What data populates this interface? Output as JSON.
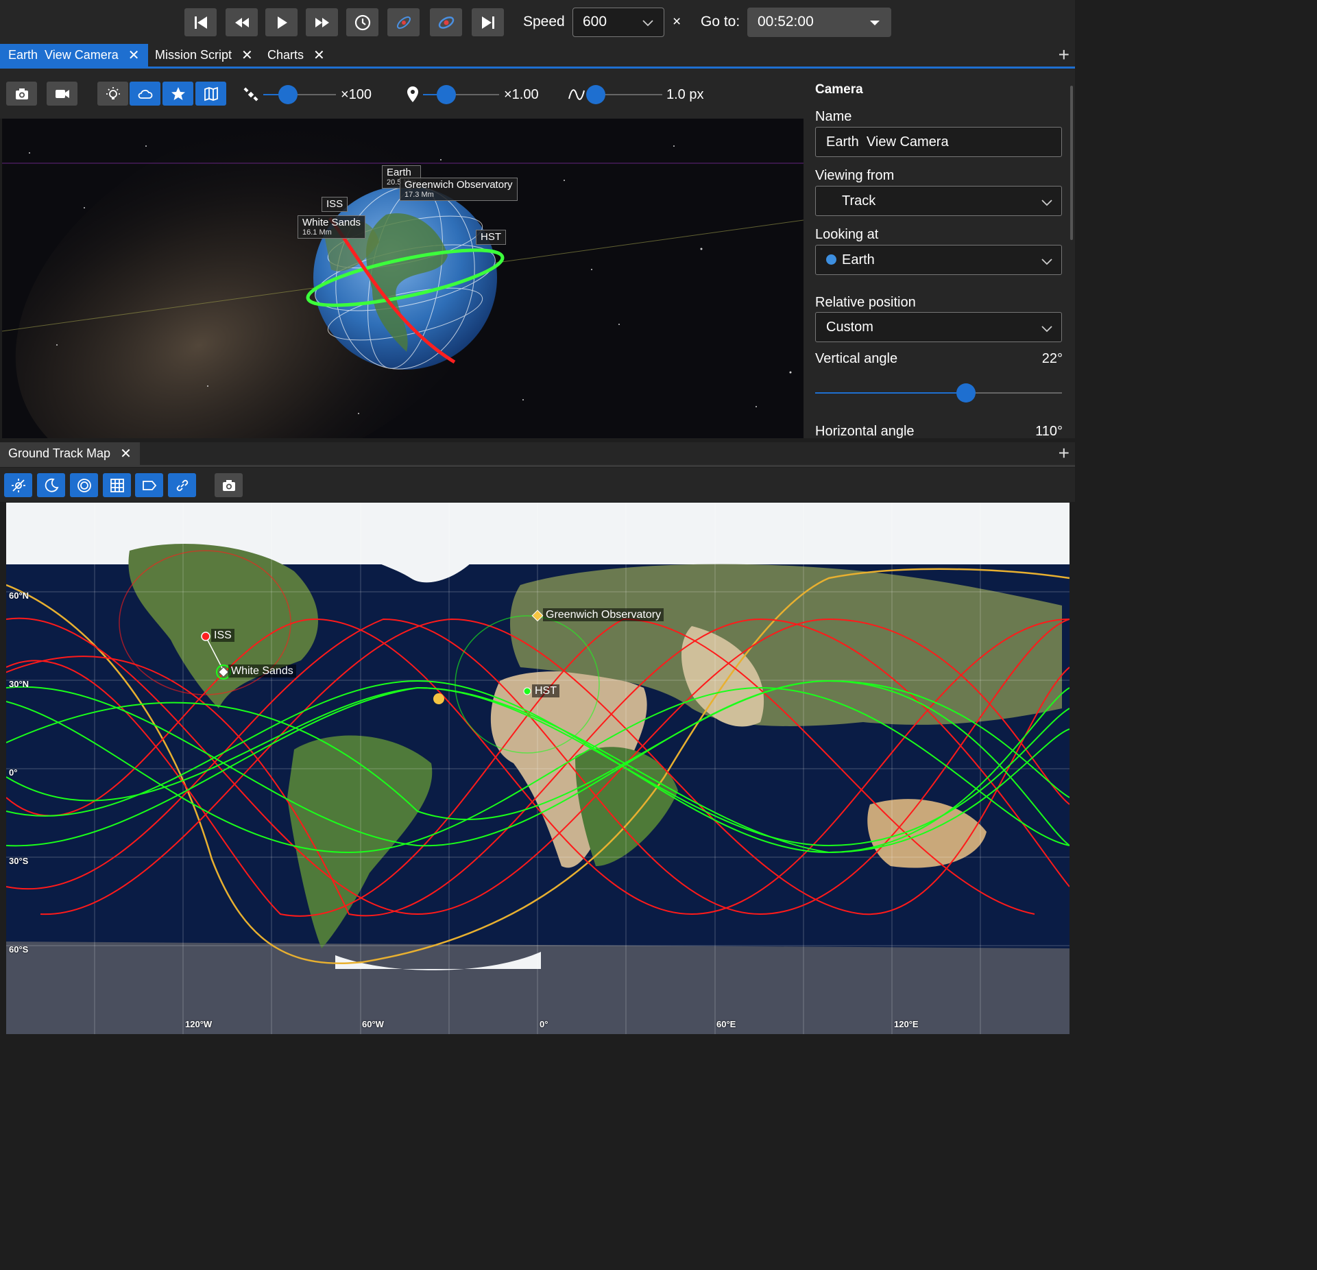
{
  "toolbar": {
    "speed_label": "Speed",
    "speed_value": "600",
    "multiplier": "×",
    "goto_label": "Go to:",
    "goto_value": "00:52:00"
  },
  "upper_tabs": [
    {
      "label": "Earth  View Camera"
    },
    {
      "label": "Mission Script"
    },
    {
      "label": "Charts"
    }
  ],
  "camera_toolbar": {
    "scale_value": "×100",
    "marker_value": "×1.00",
    "line_value": "1.0 px"
  },
  "viewport": {
    "labels": {
      "earth": "Earth",
      "earth_sub": "20.5 Mm",
      "greenwich": "Greenwich Observatory",
      "greenwich_sub": "17.3 Mm",
      "iss": "ISS",
      "white_sands": "White Sands",
      "white_sands_sub": "16.1 Mm",
      "hst": "HST"
    }
  },
  "camera_panel": {
    "title": "Camera",
    "name_label": "Name",
    "name_value": "Earth  View Camera",
    "viewing_from_label": "Viewing from",
    "viewing_from_value": "Track",
    "looking_at_label": "Looking at",
    "looking_at_value": "Earth",
    "relative_position_label": "Relative position",
    "relative_position_value": "Custom",
    "vertical_angle_label": "Vertical angle",
    "vertical_angle_value": "22°",
    "vertical_angle_fraction": 0.61,
    "horizontal_angle_label": "Horizontal angle",
    "horizontal_angle_value": "110°"
  },
  "lower_tabs": [
    {
      "label": "Ground Track Map"
    }
  ],
  "map": {
    "lat_labels": {
      "n60": "60°N",
      "n30": "30°N",
      "eq": "0°",
      "s30": "30°S",
      "s60": "60°S"
    },
    "lon_labels": {
      "w120": "120°W",
      "w60": "60°W",
      "zero": "0°",
      "e60": "60°E",
      "e120": "120°E"
    },
    "objects": {
      "greenwich": "Greenwich Observatory",
      "iss": "ISS",
      "white_sands": "White Sands",
      "hst": "HST"
    },
    "colors": {
      "iss_track": "#ff1a1a",
      "hst_track": "#1aff1a",
      "terminator": "#e8b030",
      "sun": "#f5c542"
    }
  },
  "colors": {
    "accent": "#1e6fd0"
  }
}
